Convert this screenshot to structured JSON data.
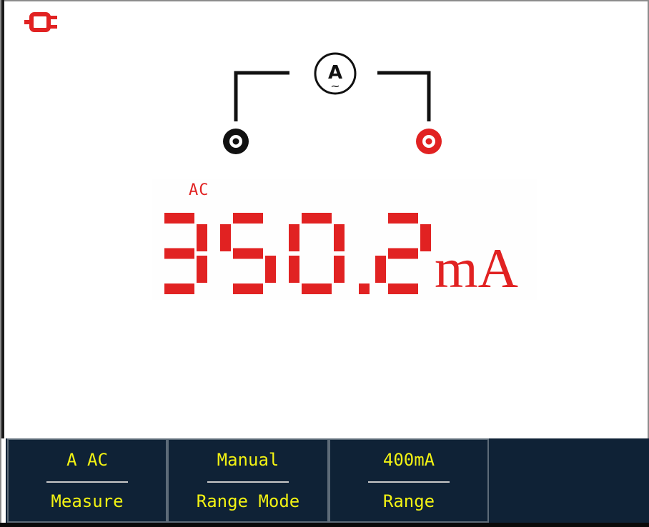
{
  "display": {
    "mode": "AC",
    "value": "350.2",
    "unit": "mA"
  },
  "meter_icon": {
    "symbol": "A",
    "wave": "~"
  },
  "softkeys": [
    {
      "value": "A AC",
      "name": "Measure"
    },
    {
      "value": "Manual",
      "name": "Range Mode"
    },
    {
      "value": "400mA",
      "name": "Range"
    }
  ],
  "icons": {
    "power": "power-plug-icon",
    "ammeter": "ammeter-icon",
    "com_terminal": "com-terminal-icon",
    "input_terminal": "input-terminal-icon"
  },
  "colors": {
    "reading": "#e12222",
    "softkey_bg": "#0f2236",
    "softkey_text": "#f2f213",
    "wire": "#111111"
  }
}
